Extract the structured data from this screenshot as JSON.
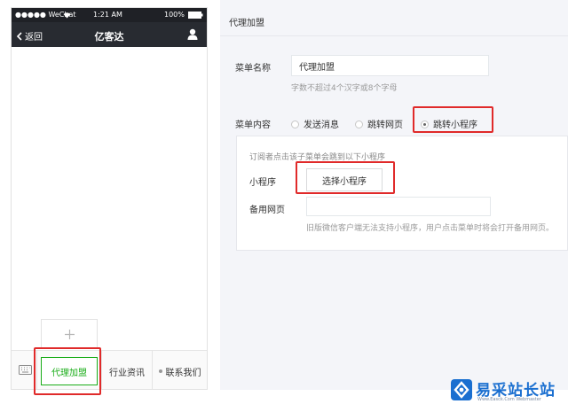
{
  "phone": {
    "status": {
      "carrier": "●●●●● WeChat",
      "time": "1:21 AM",
      "battery": "100%"
    },
    "nav": {
      "back_label": "返回",
      "title": "亿客达"
    },
    "menu": {
      "items": [
        "代理加盟",
        "行业资讯",
        "联系我们"
      ],
      "active": "代理加盟"
    }
  },
  "editor": {
    "title": "代理加盟",
    "menu_name_label": "菜单名称",
    "menu_name_value": "代理加盟",
    "menu_name_hint": "字数不超过4个汉字或8个字母",
    "menu_content_label": "菜单内容",
    "content_options": [
      "发送消息",
      "跳转网页",
      "跳转小程序"
    ],
    "selected_option": "跳转小程序",
    "panel": {
      "description": "订阅者点击该子菜单会跳到以下小程序",
      "miniprogram_label": "小程序",
      "choose_button": "选择小程序",
      "backup_label": "备用网页",
      "backup_value": "",
      "backup_hint": "旧版微信客户端无法支持小程序，用户点击菜单时将会打开备用网页。"
    }
  },
  "watermark": {
    "text": "易采站长站",
    "sub": "Www.Easck.Com Webmaster"
  },
  "colors": {
    "highlight": "#e02a2a",
    "wechat_green": "#1aad19",
    "nav_dark": "#282b31",
    "watermark_blue": "#1a6fd0"
  }
}
